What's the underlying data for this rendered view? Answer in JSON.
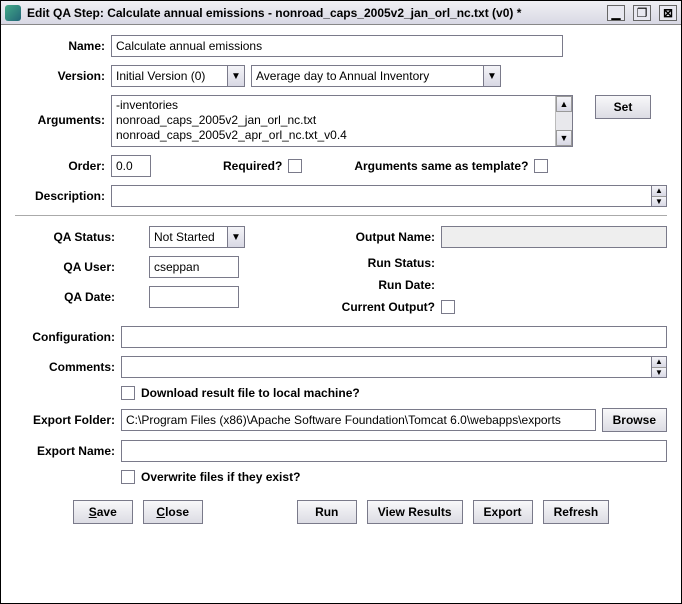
{
  "window": {
    "title": "Edit QA Step: Calculate annual emissions - nonroad_caps_2005v2_jan_orl_nc.txt (v0) *"
  },
  "form": {
    "name_label": "Name:",
    "name_value": "Calculate annual emissions",
    "version_label": "Version:",
    "version_value": "Initial Version (0)",
    "program_value": "Average day to Annual Inventory",
    "arguments_label": "Arguments:",
    "arguments_lines": "-inventories\nnonroad_caps_2005v2_jan_orl_nc.txt\nnonroad_caps_2005v2_apr_orl_nc.txt_v0.4",
    "set_button": "Set",
    "order_label": "Order:",
    "order_value": "0.0",
    "required_label": "Required?",
    "args_same_label": "Arguments same as template?",
    "description_label": "Description:",
    "description_value": ""
  },
  "status": {
    "qa_status_label": "QA Status:",
    "qa_status_value": "Not Started",
    "qa_user_label": "QA User:",
    "qa_user_value": "cseppan",
    "qa_date_label": "QA Date:",
    "qa_date_value": "",
    "output_name_label": "Output Name:",
    "output_name_value": "",
    "run_status_label": "Run Status:",
    "run_date_label": "Run Date:",
    "current_output_label": "Current Output?"
  },
  "lower": {
    "configuration_label": "Configuration:",
    "configuration_value": "",
    "comments_label": "Comments:",
    "comments_value": "",
    "download_label": "Download result file to local machine?",
    "export_folder_label": "Export Folder:",
    "export_folder_value": "C:\\Program Files (x86)\\Apache Software Foundation\\Tomcat 6.0\\webapps\\exports",
    "browse_button": "Browse",
    "export_name_label": "Export Name:",
    "export_name_value": "",
    "overwrite_label": "Overwrite files if they exist?"
  },
  "buttons": {
    "save": "Save",
    "close": "Close",
    "run": "Run",
    "view_results": "View Results",
    "export": "Export",
    "refresh": "Refresh"
  }
}
